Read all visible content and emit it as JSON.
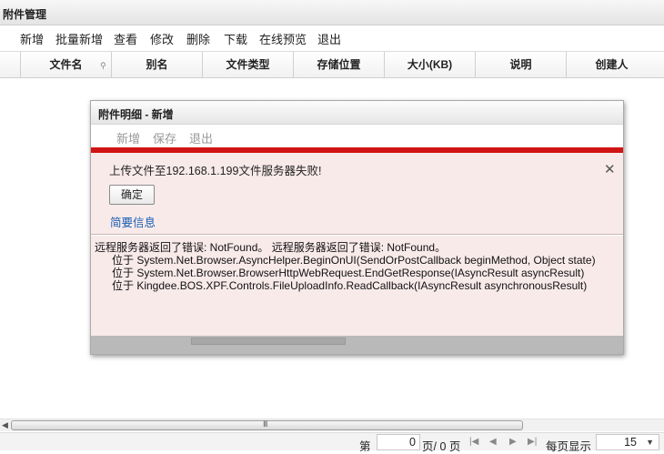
{
  "window": {
    "title": "附件管理"
  },
  "toolbar": {
    "items": [
      "新增",
      "批量新增",
      "查看",
      "修改",
      "删除",
      "下载",
      "在线预览",
      "退出"
    ]
  },
  "grid": {
    "columns": [
      "文件名",
      "别名",
      "文件类型",
      "存储位置",
      "大小(KB)",
      "说明",
      "创建人"
    ]
  },
  "dialog": {
    "title": "附件明细 - 新增",
    "toolbar": [
      "新增",
      "保存",
      "退出"
    ],
    "error": {
      "message": "上传文件至192.168.1.199文件服务器失败!",
      "ok_label": "确定",
      "summary_link": "简要信息",
      "details": [
        "远程服务器返回了错误: NotFound。 远程服务器返回了错误: NotFound。",
        "位于  System.Net.Browser.AsyncHelper.BeginOnUI(SendOrPostCallback beginMethod, Object state)",
        "位于  System.Net.Browser.BrowserHttpWebRequest.EndGetResponse(IAsyncResult asyncResult)",
        "位于  Kingdee.BOS.XPF.Controls.FileUploadInfo.ReadCallback(IAsyncResult asynchronousResult)"
      ]
    }
  },
  "scrollbar": {
    "grip": "III"
  },
  "pager": {
    "label_page": "第",
    "current": "0",
    "of_label": "页/ 0 页",
    "page_size_label": "每页显示",
    "page_size": "15"
  }
}
